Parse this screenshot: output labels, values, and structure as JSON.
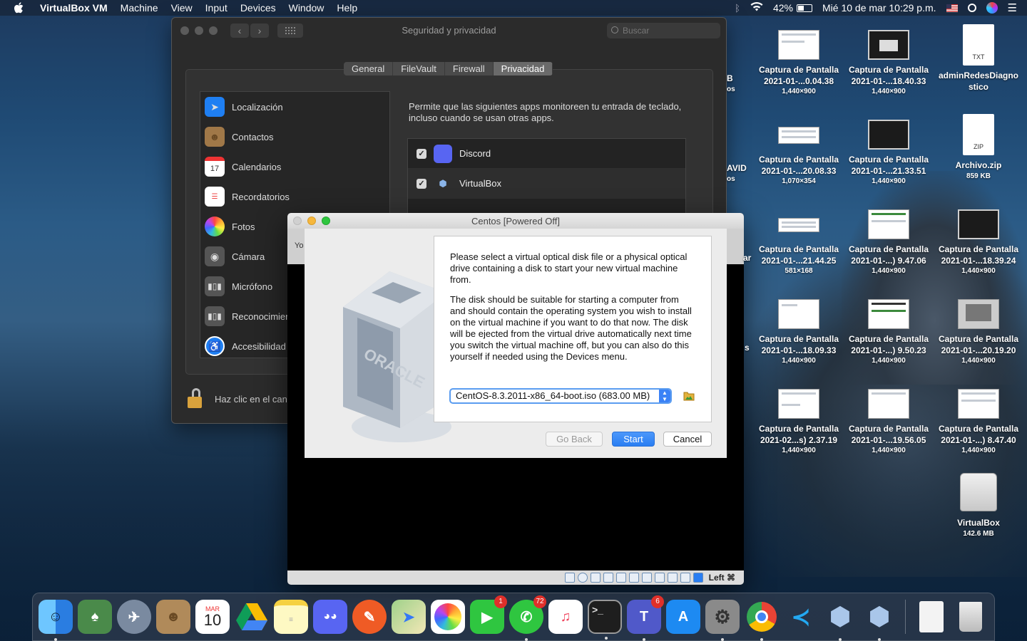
{
  "menubar": {
    "app_name": "VirtualBox VM",
    "items": [
      "Machine",
      "View",
      "Input",
      "Devices",
      "Window",
      "Help"
    ],
    "battery": "42%",
    "datetime": "Mié 10 de mar  10:29 p.m."
  },
  "prefs": {
    "title": "Seguridad y privacidad",
    "search_placeholder": "Buscar",
    "tabs": [
      "General",
      "FileVault",
      "Firewall",
      "Privacidad"
    ],
    "categories": [
      "Localización",
      "Contactos",
      "Calendarios",
      "Recordatorios",
      "Fotos",
      "Cámara",
      "Micrófono",
      "Reconocimiento",
      "Accesibilidad"
    ],
    "description": "Permite que las siguientes apps monitoreen tu entrada de teclado, incluso cuando se usan otras apps.",
    "apps": [
      {
        "name": "Discord",
        "checked": "✓"
      },
      {
        "name": "VirtualBox",
        "checked": "✓"
      }
    ],
    "lock_text": "Haz clic en el candado para hacer cambios."
  },
  "vm": {
    "title": "Centos [Powered Off]",
    "partial_left": "Yo",
    "paragraph1": "Please select a virtual optical disk file or a physical optical drive containing a disk to start your new virtual machine from.",
    "paragraph2": "The disk should be suitable for starting a computer from and should contain the operating system you wish to install on the virtual machine if you want to do that now. The disk will be ejected from the virtual drive automatically next time you switch the virtual machine off, but you can also do this yourself if needed using the Devices menu.",
    "disk_value": "CentOS-8.3.2011-x86_64-boot.iso (683.00 MB)",
    "buttons": {
      "back": "Go Back",
      "start": "Start",
      "cancel": "Cancel"
    },
    "host_key": "Left ⌘"
  },
  "desktop": {
    "partials": [
      "B",
      "os",
      "AVID",
      "os",
      "ar",
      "s"
    ],
    "items": [
      {
        "name1": "Captura de Pantalla",
        "name2": "2021-01-...0.04.38",
        "dim": "1,440×900"
      },
      {
        "name1": "Captura de Pantalla",
        "name2": "2021-01-...18.40.33",
        "dim": "1,440×900"
      },
      {
        "name1": "adminRedesDiagno",
        "name2": "stico",
        "dim": "",
        "ext": "TXT"
      },
      {
        "name1": "Captura de Pantalla",
        "name2": "2021-01-...20.08.33",
        "dim": "1,070×354"
      },
      {
        "name1": "Captura de Pantalla",
        "name2": "2021-01-...21.33.51",
        "dim": "1,440×900"
      },
      {
        "name1": "Archivo.zip",
        "name2": "859 KB",
        "dim": "",
        "ext": "ZIP"
      },
      {
        "name1": "Captura de Pantalla",
        "name2": "2021-01-...21.44.25",
        "dim": "581×168"
      },
      {
        "name1": "Captura de Pantalla",
        "name2": "2021-01-...) 9.47.06",
        "dim": "1,440×900"
      },
      {
        "name1": "Captura de Pantalla",
        "name2": "2021-01-...18.39.24",
        "dim": "1,440×900"
      },
      {
        "name1": "Captura de Pantalla",
        "name2": "2021-01-...18.09.33",
        "dim": "1,440×900"
      },
      {
        "name1": "Captura de Pantalla",
        "name2": "2021-01-...) 9.50.23",
        "dim": "1,440×900"
      },
      {
        "name1": "Captura de Pantalla",
        "name2": "2021-01-...20.19.20",
        "dim": "1,440×900"
      },
      {
        "name1": "Captura de Pantalla",
        "name2": "2021-02...s) 2.37.19",
        "dim": "1,440×900"
      },
      {
        "name1": "Captura de Pantalla",
        "name2": "2021-01-...19.56.05",
        "dim": "1,440×900"
      },
      {
        "name1": "Captura de Pantalla",
        "name2": "2021-01-...) 8.47.40",
        "dim": "1,440×900"
      },
      {
        "name1": "VirtualBox",
        "name2": "142.6 MB",
        "dim": ""
      }
    ]
  },
  "dock": {
    "calendar_month": "MAR",
    "calendar_day": "10",
    "facetime_badge": "1",
    "whatsapp_badge": "72",
    "teams_badge": "6"
  }
}
